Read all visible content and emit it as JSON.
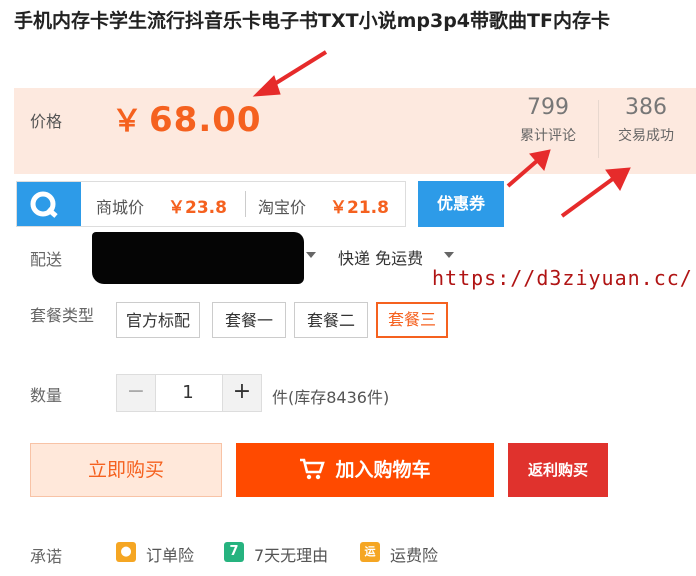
{
  "product": {
    "title": "手机内存卡学生流行抖音乐卡电子书TXT小说mp3p4带歌曲TF内存卡"
  },
  "price": {
    "label": "价格",
    "currency": "￥",
    "value": "68.00",
    "stats": [
      {
        "num": "799",
        "label": "累计评论"
      },
      {
        "num": "386",
        "label": "交易成功"
      }
    ]
  },
  "compare": {
    "mall_label": "商城价",
    "mall_price": "￥23.8",
    "taobao_label": "淘宝价",
    "taobao_price": "￥21.8",
    "coupon_button": "优惠券"
  },
  "shipping": {
    "label": "配送",
    "method": "快递 免运费"
  },
  "watermark": "https://d3ziyuan.cc/",
  "package": {
    "label": "套餐类型",
    "options": [
      "官方标配",
      "套餐一",
      "套餐二",
      "套餐三"
    ],
    "selected_index": 3
  },
  "quantity": {
    "label": "数量",
    "minus": "−",
    "value": "1",
    "plus": "+",
    "stock_text": "件(库存8436件)"
  },
  "actions": {
    "buy_now": "立即购买",
    "add_to_cart": "加入购物车",
    "rebate_buy": "返利购买"
  },
  "promise": {
    "label": "承诺",
    "items": [
      {
        "icon": "order-insurance-icon",
        "text": "订单险",
        "color": "#f5a623",
        "glyph": "●"
      },
      {
        "icon": "seven-day-return-icon",
        "text": "7天无理由",
        "color": "#26b37f",
        "glyph": "7"
      },
      {
        "icon": "shipping-insurance-icon",
        "text": "运费险",
        "color": "#f5a623",
        "glyph": "运"
      }
    ]
  },
  "colors": {
    "accent": "#f5611f",
    "cart": "#ff4a00",
    "rebate": "#e0322d",
    "coupon": "#2d9be8",
    "arrow": "#e62b2b"
  }
}
